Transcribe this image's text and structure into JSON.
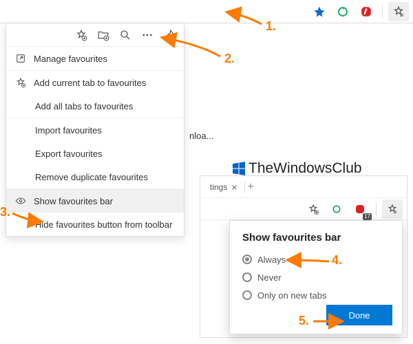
{
  "top_toolbar": {
    "icons": {
      "star": "star-filled-icon",
      "refresh": "refresh-icon",
      "shield": "adblock-icon",
      "favlist": "favourites-list-icon"
    }
  },
  "fav_panel": {
    "icon_row": {
      "add_fav": "star-add-icon",
      "add_folder": "folder-add-icon",
      "search": "search-icon",
      "more": "more-icon",
      "pin": "pin-icon"
    },
    "items": [
      {
        "icon": "open-external-icon",
        "label": "Manage favourites"
      },
      {
        "icon": "star-add-icon",
        "label": "Add current tab to favourites"
      },
      {
        "icon": "",
        "label": "Add all tabs to favourites"
      },
      {
        "sep": true
      },
      {
        "icon": "",
        "label": "Import favourites"
      },
      {
        "icon": "",
        "label": "Export favourites"
      },
      {
        "icon": "",
        "label": "Remove duplicate favourites"
      },
      {
        "sep": true
      },
      {
        "icon": "eye-icon",
        "label": "Show favourites bar",
        "hover": true
      },
      {
        "icon": "",
        "label": "Hide favourites button from toolbar"
      }
    ]
  },
  "truncated_text": "nloa...",
  "watermark": {
    "text": "TheWindowsClub"
  },
  "right_window": {
    "tab": {
      "label": "tings"
    },
    "toolbar": {
      "add_fav": "star-add-icon",
      "refresh": "refresh-icon",
      "shield_badge": "17",
      "favlist": "favourites-list-icon"
    },
    "popup": {
      "title": "Show favourites bar",
      "options": [
        {
          "label": "Always",
          "checked": true
        },
        {
          "label": "Never",
          "checked": false
        },
        {
          "label": "Only on new tabs",
          "checked": false
        }
      ],
      "done": "Done"
    }
  },
  "annotations": {
    "n1": "1.",
    "n2": "2.",
    "n3": "3.",
    "n4": "4.",
    "n5": "5."
  },
  "colors": {
    "accent": "#0078d4",
    "anno": "#ff7a00",
    "star": "#1069d3",
    "refresh": "#19a55a",
    "shield": "#d22"
  }
}
